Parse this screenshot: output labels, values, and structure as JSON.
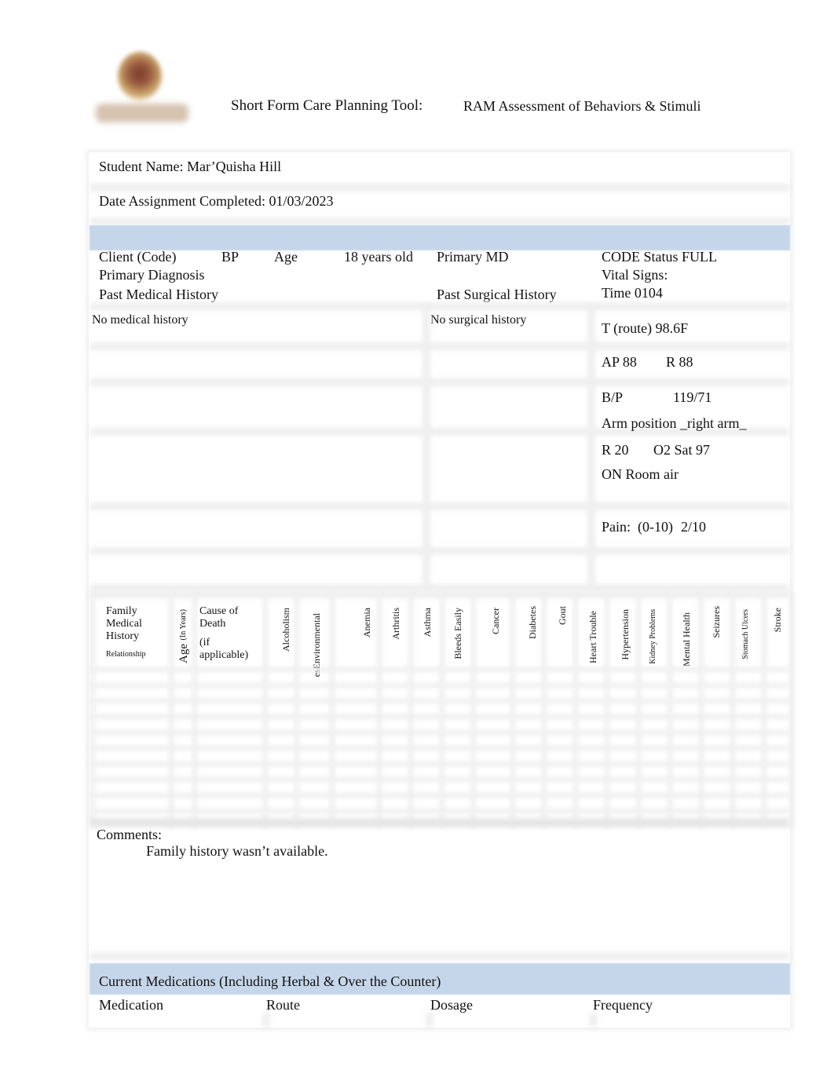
{
  "header": {
    "logo": "institution-crest-logo",
    "title_left": "Short Form Care Planning Tool:",
    "title_right": "RAM Assessment of Behaviors & Stimuli"
  },
  "student": {
    "name_line": "Student Name: Mar’Quisha Hill",
    "date_line": "Date Assignment Completed: 01/03/2023"
  },
  "client": {
    "client_code_label": "Client  (Code)",
    "bp_label": "BP",
    "age_label": "Age",
    "age_value": "18 years old",
    "primary_md_label": "Primary MD",
    "primary_diagnosis_label": "Primary Diagnosis",
    "past_medical_label": "Past Medical History",
    "past_medical_value": "No medical history",
    "past_surgical_label": "Past Surgical History",
    "past_surgical_value": "No surgical history"
  },
  "vitals": {
    "code_status": "CODE Status FULL",
    "vital_signs_label": "Vital Signs:",
    "time": "Time 0104",
    "temp": "T (route) 98.6F",
    "ap": "AP 88",
    "r_pulse": "R 88",
    "bp_label": "B/P",
    "bp_value": "119/71",
    "arm_position": "Arm position _right arm_",
    "resp": "R 20",
    "o2_sat": "O2 Sat 97",
    "on_air": "ON Room air",
    "pain_label": "Pain:",
    "pain_scale": "(0-10)",
    "pain_value": "2/10"
  },
  "family_history": {
    "col_family": [
      "Family",
      "Medical",
      "History"
    ],
    "col_relationship": "Relationship",
    "col_age": "Age",
    "col_age_unit": "(In Years)",
    "col_cause": [
      "Cause of",
      "Death"
    ],
    "col_cause_note": [
      "(if",
      "applicable)"
    ],
    "conditions": [
      "Alcoholism",
      "esEnvironmental",
      "Anemia",
      "Arthritis",
      "Asthma",
      "Bleeds Easily",
      "Cancer",
      "Diabetes",
      "Gout",
      "Heart Trouble",
      "Hypertension",
      "Kidney Problems",
      "Mental Health",
      "Seizures",
      "Stomach Ulcers",
      "Stroke"
    ]
  },
  "comments": {
    "label": "Comments:",
    "text": "Family history wasn’t available."
  },
  "medications": {
    "section_title": "Current Medications (Including Herbal & Over the Counter)",
    "columns": [
      "Medication",
      "Route",
      "Dosage",
      "Frequency"
    ]
  },
  "colors": {
    "section_band": "#c6d6ea",
    "grid_line": "#efefef"
  }
}
